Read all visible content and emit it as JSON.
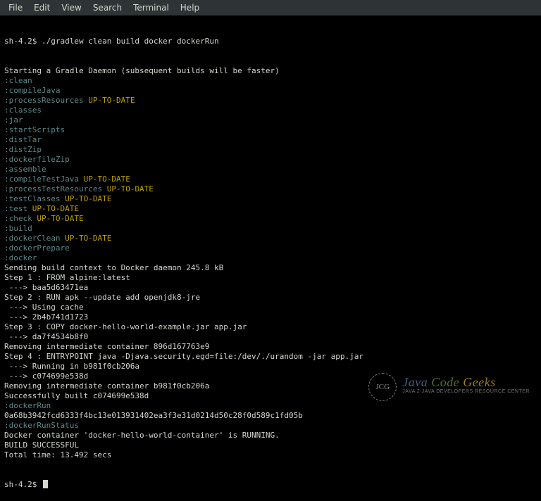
{
  "menubar": {
    "items": [
      "File",
      "Edit",
      "View",
      "Search",
      "Terminal",
      "Help"
    ]
  },
  "terminal": {
    "prompt": "sh-4.2$",
    "command": "./gradlew clean build docker dockerRun",
    "lines": [
      {
        "cls": "plain",
        "text": "Starting a Gradle Daemon (subsequent builds will be faster)"
      },
      {
        "cls": "task",
        "text": ":clean"
      },
      {
        "cls": "task",
        "text": ":compileJava"
      },
      {
        "cls": "task",
        "text": ":processResources",
        "status": "UP-TO-DATE"
      },
      {
        "cls": "task",
        "text": ":classes"
      },
      {
        "cls": "task",
        "text": ":jar"
      },
      {
        "cls": "task",
        "text": ":startScripts"
      },
      {
        "cls": "task",
        "text": ":distTar"
      },
      {
        "cls": "task",
        "text": ":distZip"
      },
      {
        "cls": "task",
        "text": ":dockerfileZip"
      },
      {
        "cls": "task",
        "text": ":assemble"
      },
      {
        "cls": "task",
        "text": ":compileTestJava",
        "status": "UP-TO-DATE"
      },
      {
        "cls": "task",
        "text": ":processTestResources",
        "status": "UP-TO-DATE"
      },
      {
        "cls": "task",
        "text": ":testClasses",
        "status": "UP-TO-DATE"
      },
      {
        "cls": "task",
        "text": ":test",
        "status": "UP-TO-DATE"
      },
      {
        "cls": "task",
        "text": ":check",
        "status": "UP-TO-DATE"
      },
      {
        "cls": "task",
        "text": ":build"
      },
      {
        "cls": "task",
        "text": ":dockerClean",
        "status": "UP-TO-DATE"
      },
      {
        "cls": "task",
        "text": ":dockerPrepare"
      },
      {
        "cls": "task",
        "text": ":docker"
      },
      {
        "cls": "plain",
        "text": "Sending build context to Docker daemon 245.8 kB"
      },
      {
        "cls": "plain",
        "text": "Step 1 : FROM alpine:latest"
      },
      {
        "cls": "plain",
        "text": " ---> baa5d63471ea"
      },
      {
        "cls": "plain",
        "text": "Step 2 : RUN apk --update add openjdk8-jre"
      },
      {
        "cls": "plain",
        "text": " ---> Using cache"
      },
      {
        "cls": "plain",
        "text": " ---> 2b4b741d1723"
      },
      {
        "cls": "plain",
        "text": "Step 3 : COPY docker-hello-world-example.jar app.jar"
      },
      {
        "cls": "plain",
        "text": " ---> da7f4534b8f0"
      },
      {
        "cls": "plain",
        "text": "Removing intermediate container 896d167763e9"
      },
      {
        "cls": "plain",
        "text": "Step 4 : ENTRYPOINT java -Djava.security.egd=file:/dev/./urandom -jar app.jar"
      },
      {
        "cls": "plain",
        "text": " ---> Running in b981f0cb206a"
      },
      {
        "cls": "plain",
        "text": " ---> c074699e538d"
      },
      {
        "cls": "plain",
        "text": "Removing intermediate container b981f0cb206a"
      },
      {
        "cls": "plain",
        "text": "Successfully built c074699e538d"
      },
      {
        "cls": "task",
        "text": ":dockerRun"
      },
      {
        "cls": "plain",
        "text": "0a68b3942fcd6333f4bc13e013931402ea3f3e31d0214d50c28f0d589c1fd05b"
      },
      {
        "cls": "task",
        "text": ":dockerRunStatus"
      },
      {
        "cls": "plain",
        "text": "Docker container 'docker-hello-world-container' is RUNNING."
      },
      {
        "cls": "plain",
        "text": ""
      },
      {
        "cls": "plain",
        "text": "BUILD SUCCESSFUL"
      },
      {
        "cls": "plain",
        "text": ""
      },
      {
        "cls": "plain",
        "text": "Total time: 13.492 secs"
      }
    ]
  },
  "watermark": {
    "monogram": "JCG",
    "title_java": "Java",
    "title_code": "Code",
    "title_geeks": "Geeks",
    "subtitle": "Java 2 Java Developers Resource Center"
  }
}
